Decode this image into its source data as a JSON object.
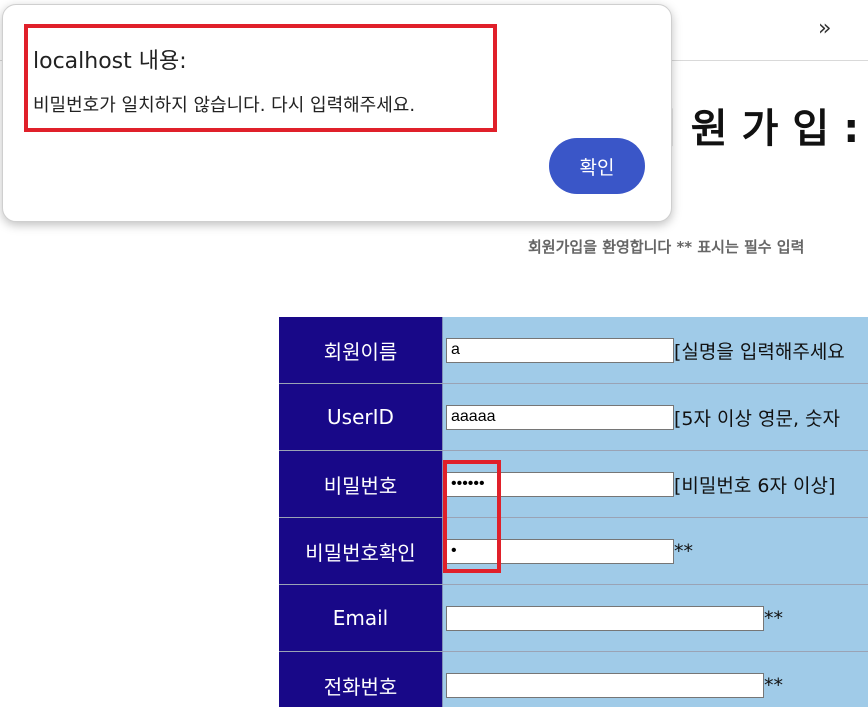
{
  "header": {
    "chevron": "»"
  },
  "page": {
    "title": "회원가입:",
    "subtitle": "회원가입을 환영합니다 ** 표시는 필수 입력"
  },
  "form": {
    "rows": [
      {
        "label": "회원이름",
        "value": "a",
        "hint": "[실명을 입력해주세요"
      },
      {
        "label": "UserID",
        "value": "aaaaa",
        "hint": "[5자 이상 영문, 숫자"
      },
      {
        "label": "비밀번호",
        "value": "••••••",
        "hint": "[비밀번호 6자 이상]"
      },
      {
        "label": "비밀번호확인",
        "value": "•",
        "hint": "**"
      },
      {
        "label": "Email",
        "value": "",
        "hint": "**"
      },
      {
        "label": "전화번호",
        "value": "",
        "hint": "**"
      }
    ]
  },
  "dialog": {
    "title": "localhost 내용:",
    "message": "비밀번호가 일치하지 않습니다. 다시 입력해주세요.",
    "ok_label": "확인"
  },
  "colors": {
    "label_bg": "#180888",
    "field_bg": "#a0cbe8",
    "highlight": "#e0202a",
    "button": "#3a56c8"
  }
}
